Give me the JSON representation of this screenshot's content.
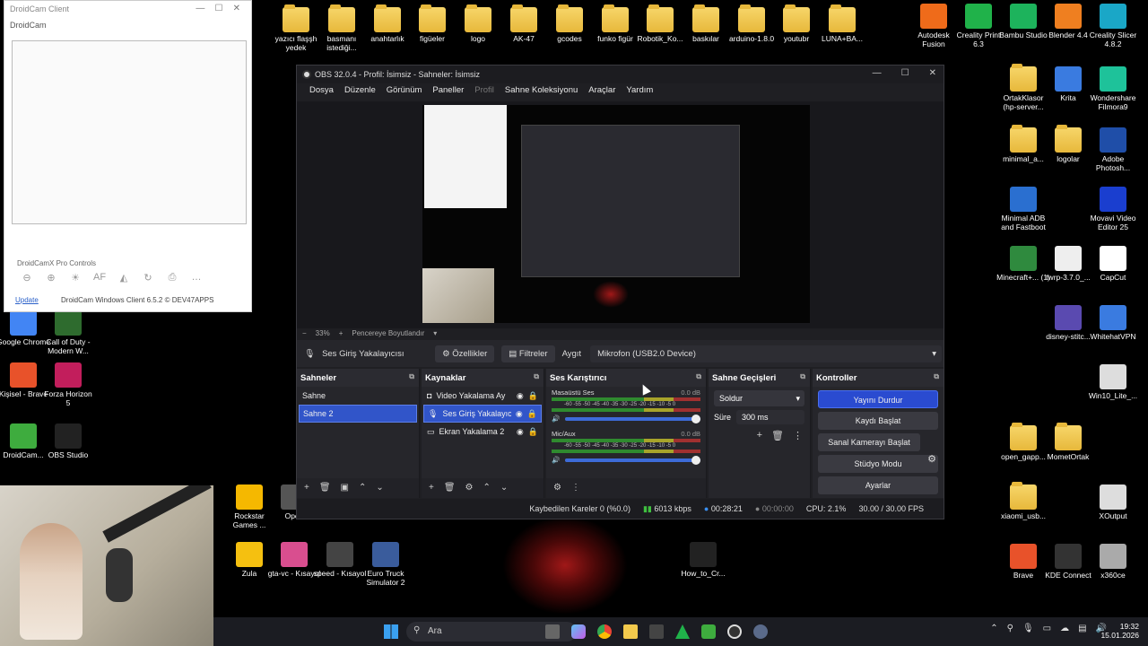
{
  "desktop": {
    "top_icons": [
      "yazıcı flaşşh yedek",
      "basmanı istediği...",
      "anahtarlık",
      "figüeler",
      "logo",
      "AK-47",
      "gcodes",
      "funko figür",
      "Robotik_Ko...",
      "baskılar",
      "arduino-1.8.0",
      "youtubr",
      "LUNA+BA..."
    ],
    "right_icons": [
      {
        "label": "Autodesk Fusion",
        "color": "#ef6b1a"
      },
      {
        "label": "Creality Print 6.3",
        "color": "#20b24a"
      },
      {
        "label": "Bambu Studio",
        "color": "#1db35c"
      },
      {
        "label": "Blender 4.4",
        "color": "#ef7f20"
      },
      {
        "label": "Creality Slicer 4.8.2",
        "color": "#1aa7c7"
      },
      {
        "label": "OrtakKlasor (hp-server...",
        "color": "#f2c94c"
      },
      {
        "label": "Krita",
        "color": "#3a7be0"
      },
      {
        "label": "Wondershare Filmora9",
        "color": "#1ec29a"
      },
      {
        "label": "minimal_a...",
        "color": "#f2c94c"
      },
      {
        "label": "logolar",
        "color": "#f2c94c"
      },
      {
        "label": "Adobe Photosh...",
        "color": "#1f4ea8"
      },
      {
        "label": "Minimal ADB and Fastboot",
        "color": "#2a6fd0"
      },
      {
        "label": "Movavi Video Editor 25",
        "color": "#1a3ecf"
      },
      {
        "label": "Minecraft+... (1)",
        "color": "#2f8a3e"
      },
      {
        "label": "twrp-3.7.0_...",
        "color": "#eeeeee"
      },
      {
        "label": "CapCut",
        "color": "#ffffff"
      },
      {
        "label": "disney-stitc...",
        "color": "#5a4ab0"
      },
      {
        "label": "WhitehatVPN",
        "color": "#3a7be0"
      },
      {
        "label": "Win10_Lite_...",
        "color": "#dddddd"
      },
      {
        "label": "open_gapp...",
        "color": "#f2c94c"
      },
      {
        "label": "MometOrtak",
        "color": "#f2c94c"
      },
      {
        "label": "xiaomi_usb...",
        "color": "#f2c94c"
      },
      {
        "label": "XOutput",
        "color": "#dddddd"
      },
      {
        "label": "Brave",
        "color": "#e8522a"
      },
      {
        "label": "KDE Connect",
        "color": "#333333"
      },
      {
        "label": "x360ce",
        "color": "#aaaaaa"
      }
    ],
    "left_icons": [
      {
        "label": "Google Chrome",
        "color": "#4285f4"
      },
      {
        "label": "Call of Duty - Modern W...",
        "color": "#2e6b2e"
      },
      {
        "label": "Kişisel - Brave",
        "color": "#e8522a"
      },
      {
        "label": "Forza Horizon 5",
        "color": "#c21e5c"
      },
      {
        "label": "DroidCam...",
        "color": "#3eac3e"
      },
      {
        "label": "OBS Studio",
        "color": "#222222"
      }
    ],
    "bottom_icons": [
      {
        "label": "Rockstar Games ...",
        "color": "#f5b800"
      },
      {
        "label": "Open",
        "color": "#555555"
      },
      {
        "label": "Zula",
        "color": "#f5c010"
      },
      {
        "label": "gta-vc - Kısayol",
        "color": "#d94e8f"
      },
      {
        "label": "speed - Kısayol",
        "color": "#444444"
      },
      {
        "label": "Euro Truck Simulator 2",
        "color": "#3a5c9c"
      },
      {
        "label": "How_to_Cr...",
        "color": "#222222"
      }
    ]
  },
  "droidcam": {
    "title": "DroidCam Client",
    "menu": "DroidCam",
    "pro_controls": "DroidCamX Pro Controls",
    "update": "Update",
    "version": "DroidCam Windows Client 6.5.2 © DEV47APPS",
    "tools": [
      "⊖",
      "⊕",
      "☀",
      "AF",
      "◭",
      "↻",
      "⎙",
      "…"
    ]
  },
  "obs": {
    "title": "OBS 32.0.4 - Profil: İsimsiz - Sahneler: İsimsiz",
    "menu": [
      "Dosya",
      "Düzenle",
      "Görünüm",
      "Paneller",
      "Profil",
      "Sahne Koleksiyonu",
      "Araçlar",
      "Yardım"
    ],
    "zoom": "33%",
    "fit": "Pencereye Boyutlandır",
    "source_bar": {
      "name": "Ses Giriş Yakalayıcısı",
      "properties": "Özellikler",
      "filters": "Filtreler",
      "device_label": "Aygıt",
      "device": "Mikrofon (USB2.0 Device)"
    },
    "scenes": {
      "title": "Sahneler",
      "items": [
        "Sahne",
        "Sahne 2"
      ],
      "selected": 1
    },
    "sources": {
      "title": "Kaynaklar",
      "items": [
        "Video Yakalama Ay",
        "Ses Giriş Yakalayıcısı",
        "Ekran Yakalama 2"
      ],
      "selected": 1
    },
    "mixer": {
      "title": "Ses Karıştırıcı",
      "channels": [
        {
          "name": "Masaüstü Ses",
          "db": "0.0 dB",
          "volume": 1.0
        },
        {
          "name": "Mic/Aux",
          "db": "0.0 dB",
          "volume": 1.0
        }
      ],
      "scale": "-60 -55 -50 -45 -40 -35 -30 -25 -20 -15 -10 -5 0"
    },
    "transitions": {
      "title": "Sahne Geçişleri",
      "type": "Soldur",
      "duration_label": "Süre",
      "duration": "300 ms"
    },
    "controls": {
      "title": "Kontroller",
      "buttons": [
        "Yayını Durdur",
        "Kaydı Başlat",
        "Sanal Kamerayı Başlat",
        "Stüdyo Modu",
        "Ayarlar"
      ]
    },
    "status": {
      "dropped": "Kaybedilen Kareler 0 (%0.0)",
      "bitrate": "6013 kbps",
      "stream_time": "00:28:21",
      "rec_time": "00:00:00",
      "cpu": "CPU: 2.1%",
      "fps": "30.00 / 30.00 FPS"
    }
  },
  "taskbar": {
    "search": "Ara",
    "time": "19:32",
    "date": "15.01.2026"
  }
}
